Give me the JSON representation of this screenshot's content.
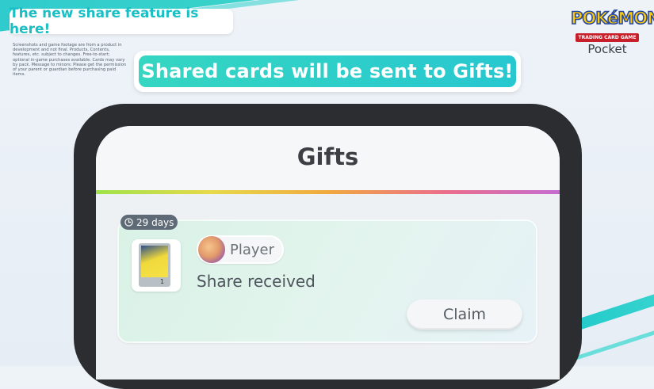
{
  "promo": {
    "top_banner": "The new share feature is here!",
    "disclaimer": "Screenshots and game footage are from a product in development and not final. Products, Contents, features, etc. subject to changes. Free-to-start; optional in-game purchases available. Cards may vary by pack. Message to minors: Please get the permission of your parent or guardian before purchasing paid items.",
    "headline": "Shared cards will be sent to Gifts!"
  },
  "logo": {
    "brand": "POKéMON",
    "subtitle": "TRADING CARD GAME",
    "product": "Pocket"
  },
  "screen": {
    "title": "Gifts",
    "gift": {
      "expiry": "29 days",
      "sender": "Player",
      "message": "Share received",
      "card_number": "1",
      "claim_label": "Claim"
    }
  },
  "colors": {
    "accent": "#19bfc3",
    "headline_gradient_start": "#35d6c2",
    "headline_gradient_end": "#27c7d0",
    "phone_frame": "#2b2d31",
    "badge": "#5f6a77"
  },
  "icons": {
    "expiry": "clock-icon"
  }
}
